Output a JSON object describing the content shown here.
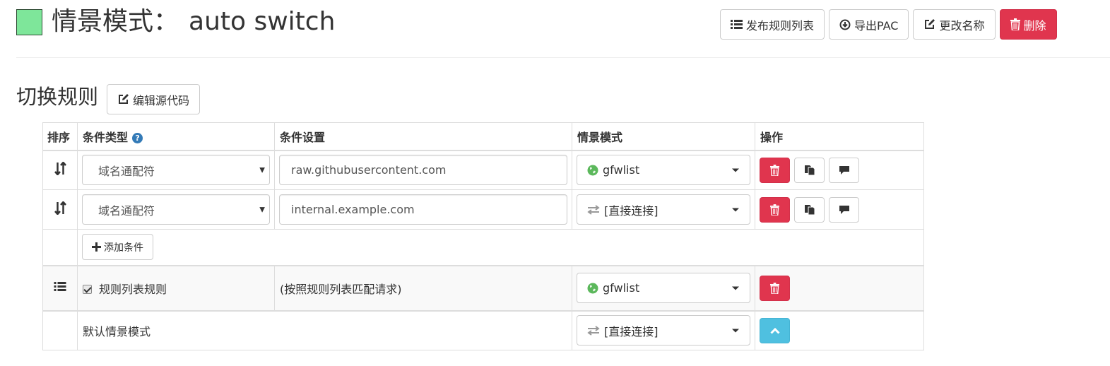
{
  "header": {
    "swatch_color": "#7ee69a",
    "title_prefix": "情景模式：",
    "profile_name": "auto switch",
    "buttons": {
      "publish": "发布规则列表",
      "export": "导出PAC",
      "rename": "更改名称",
      "delete": "删除"
    }
  },
  "section": {
    "title": "切换规则",
    "edit_source": "编辑源代码"
  },
  "table": {
    "headers": {
      "sort": "排序",
      "condition_type": "条件类型",
      "condition_settings": "条件设置",
      "profile": "情景模式",
      "actions": "操作"
    },
    "rows": [
      {
        "condition_type": "域名通配符",
        "condition": "raw.githubusercontent.com",
        "profile": "gfwlist",
        "profile_icon": "globe-icon"
      },
      {
        "condition_type": "域名通配符",
        "condition": "internal.example.com",
        "profile": "[直接连接]",
        "profile_icon": "direct-arrows-icon"
      }
    ],
    "add_condition": "添加条件",
    "rule_list": {
      "checked": true,
      "label": "规则列表规则",
      "description": "(按照规则列表匹配请求)",
      "profile": "gfwlist"
    },
    "default": {
      "label": "默认情景模式",
      "profile": "[直接连接]"
    }
  },
  "colors": {
    "danger": "#e0354e",
    "info": "#4fc0e0",
    "globe": "#5cb85c",
    "help": "#337ab7"
  }
}
